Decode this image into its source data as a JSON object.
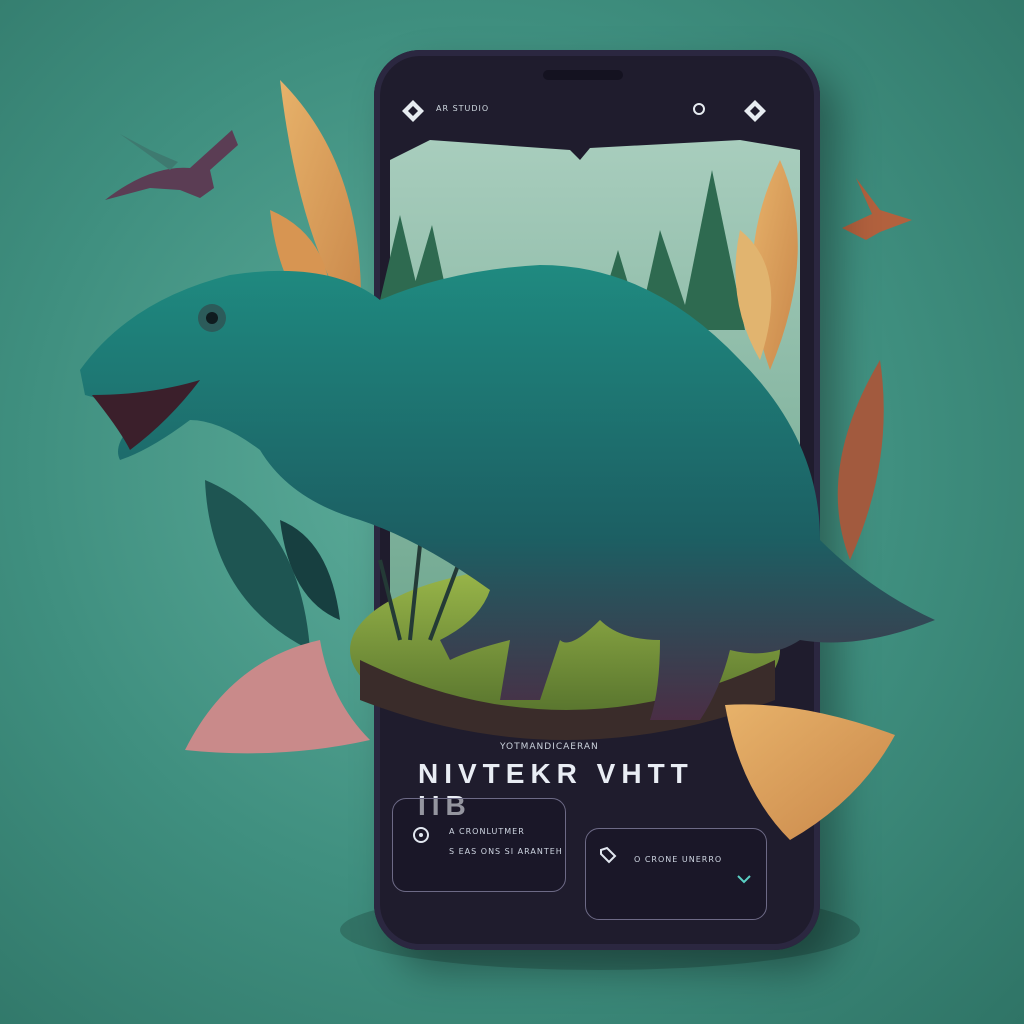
{
  "app": {
    "name": "AR STUDIO",
    "title_small": "YOTMANDICAERAN",
    "title_main": "NIVTEKR VHTT IIB"
  },
  "card_left": {
    "line1": "A CRONLUTMER",
    "line2": "S EAS ONS SI ARANTEH"
  },
  "card_right": {
    "line1": "O CRONE UNERRO"
  },
  "icons": {
    "logo": "diamond-logo-icon",
    "status_circle": "circle-icon",
    "status_diamond": "diamond-icon",
    "card_left": "location-icon",
    "card_right": "tag-icon",
    "card_right_chevron": "chevron-down-icon"
  },
  "colors": {
    "background": "#3f8f7f",
    "phone_body": "#1f1c2d",
    "dinosaur": "#1f7a70",
    "leaf_gold": "#d8a45a",
    "leaf_dark": "#1e5552"
  }
}
